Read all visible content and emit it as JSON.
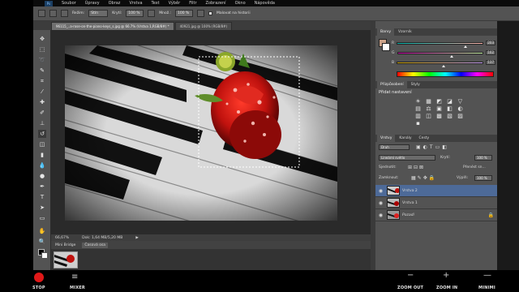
{
  "app": {
    "ps_logo": "Ps"
  },
  "menubar": {
    "items": [
      "Soubor",
      "Úpravy",
      "Obraz",
      "Vrstva",
      "Text",
      "Výběr",
      "Filtr",
      "Zobrazení",
      "Okno",
      "Nápověda"
    ]
  },
  "options": {
    "mode_label": "Režim:",
    "mode_value": "Stín",
    "opacity_label": "Krytí:",
    "opacity_value": "100 %",
    "flow_label": "Množ.:",
    "flow_value": "100 %",
    "history_label": "Malovat na historii"
  },
  "tabs": [
    {
      "label": "96115_..a-rose-on-the-piano-keys_s.jpg @ 66.7% (Vrstva 1,RGB/8#) *",
      "active": true
    },
    {
      "label": "40921.jpg @ 100% (RGB/8#)",
      "active": false
    }
  ],
  "status": {
    "zoom": "66,67%",
    "doc_size": "Dok: 1,64 MB/5,20 MB"
  },
  "minibridge": {
    "tabs": [
      "Mini Bridge",
      "Časová osa"
    ]
  },
  "color_panel": {
    "tabs": [
      "Barvy",
      "Vzorník"
    ],
    "rows": [
      {
        "label": "R",
        "value": "203",
        "position": 0.8,
        "gradient": "linear-gradient(90deg,#00b1a9,#ffb1a9)"
      },
      {
        "label": "G",
        "value": "162",
        "position": 0.64,
        "gradient": "linear-gradient(90deg,#cb00a9,#cbffa9)"
      },
      {
        "label": "B",
        "value": "137",
        "position": 0.54,
        "gradient": "linear-gradient(90deg,#cba200,#cba2ff)"
      }
    ],
    "foreground_color": "#cba289"
  },
  "adjustments": {
    "tabs": [
      "Přizpůsobení",
      "Styly"
    ],
    "heading": "Přidat nastavení",
    "icons": [
      "☀",
      "▦",
      "◩",
      "◪",
      "▽",
      "▤",
      "⚖",
      "▣",
      "◧",
      "◐",
      "▥",
      "◫",
      "▩",
      "▧",
      "▨",
      "▪"
    ]
  },
  "layers": {
    "tabs": [
      "Vrstvy",
      "Kanály",
      "Cesty"
    ],
    "filter_label": "Druh",
    "blend_mode": "Lineární světlo",
    "opacity_label": "Krytí:",
    "opacity_value": "100 %",
    "lock_label": "Zamknout:",
    "fill_label": "Výplň:",
    "fill_value": "100 %",
    "sjednotit_label": "Sjednotit:",
    "propagate_label": "Přenést sn...",
    "items": [
      {
        "name": "Vrstva 2",
        "selected": true
      },
      {
        "name": "Vrstva 1",
        "selected": false
      },
      {
        "name": "Pozadí",
        "selected": false
      }
    ]
  },
  "bottom": {
    "stop_label": "STOP",
    "mixer_label": "MIXER",
    "zoom_out_label": "ZOOM OUT",
    "zoom_in_label": "ZOOM IN",
    "minimize_label": "MINIMI"
  }
}
